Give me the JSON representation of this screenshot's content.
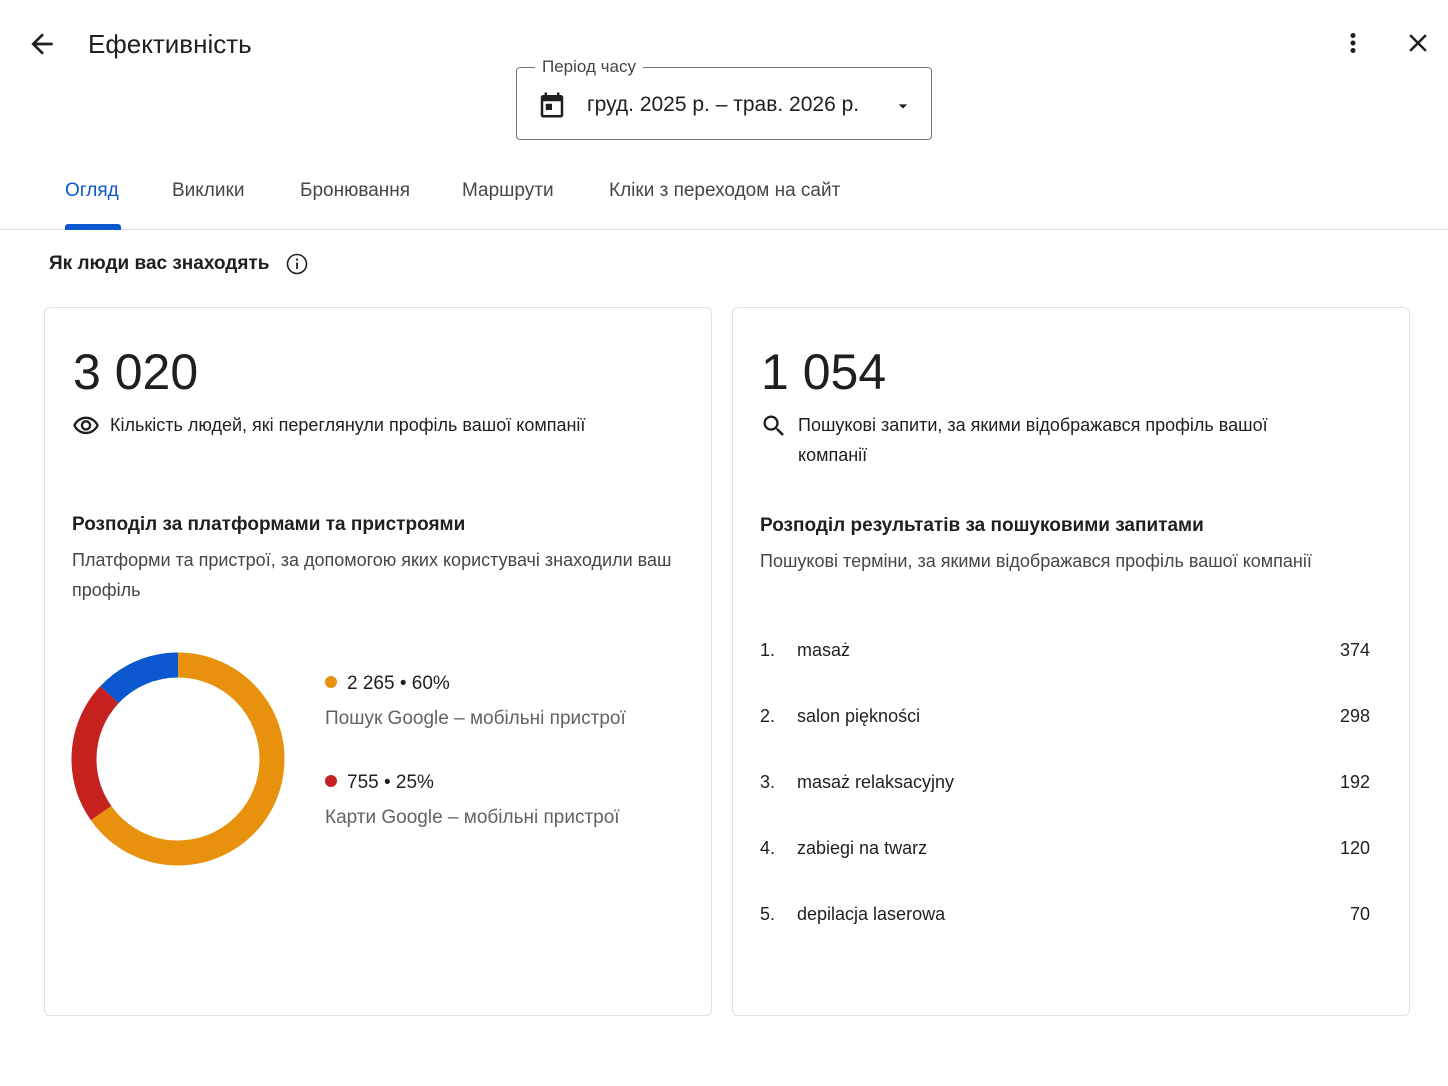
{
  "header": {
    "title": "Ефективність",
    "back_icon": "arrow-back-icon",
    "more_icon": "more-vert-icon",
    "close_icon": "close-icon"
  },
  "period": {
    "label": "Період часу",
    "value": "груд. 2025 р. – трав. 2026 р.",
    "icon": "calendar-icon"
  },
  "tabs": [
    {
      "label": "Огляд",
      "active": true
    },
    {
      "label": "Виклики",
      "active": false
    },
    {
      "label": "Бронювання",
      "active": false
    },
    {
      "label": "Маршрути",
      "active": false
    },
    {
      "label": "Кліки з переходом на сайт",
      "active": false
    }
  ],
  "section": {
    "heading": "Як люди вас знаходять",
    "info_icon": "info-icon"
  },
  "views_card": {
    "total": "3 020",
    "label": "Кількість людей, які переглянули профіль вашої компанії",
    "icon": "eye-icon",
    "breakdown_title": "Розподіл за платформами та пристроями",
    "breakdown_desc": "Платформи та пристрої, за допомогою яких користувачі знаходили ваш профіль",
    "segments": [
      {
        "value": 2265,
        "percent": 60,
        "summary": "2 265 • 60%",
        "label": "Пошук Google – мобільні пристрої",
        "color": "#e8910c",
        "in_legend": true
      },
      {
        "value": 755,
        "percent": 25,
        "summary": "755 • 25%",
        "label": "Карти Google – мобільні пристрої",
        "color": "#c5221f",
        "in_legend": true
      },
      {
        "value": 453,
        "percent": 15,
        "color": "#0b57d0",
        "in_legend": false
      }
    ]
  },
  "search_card": {
    "total": "1 054",
    "label": "Пошукові запити, за якими відображався профіль вашої компанії",
    "icon": "search-icon",
    "breakdown_title": "Розподіл результатів за пошуковими запитами",
    "breakdown_desc": "Пошукові терміни, за якими відображався профіль вашої компанії",
    "queries": [
      {
        "rank": "1.",
        "term": "masaż",
        "count": "374"
      },
      {
        "rank": "2.",
        "term": "salon piękności",
        "count": "298"
      },
      {
        "rank": "3.",
        "term": "masaż relaksacyjny",
        "count": "192"
      },
      {
        "rank": "4.",
        "term": "zabiegi na twarz",
        "count": "120"
      },
      {
        "rank": "5.",
        "term": "depilacja laserowa",
        "count": "70"
      }
    ]
  }
}
